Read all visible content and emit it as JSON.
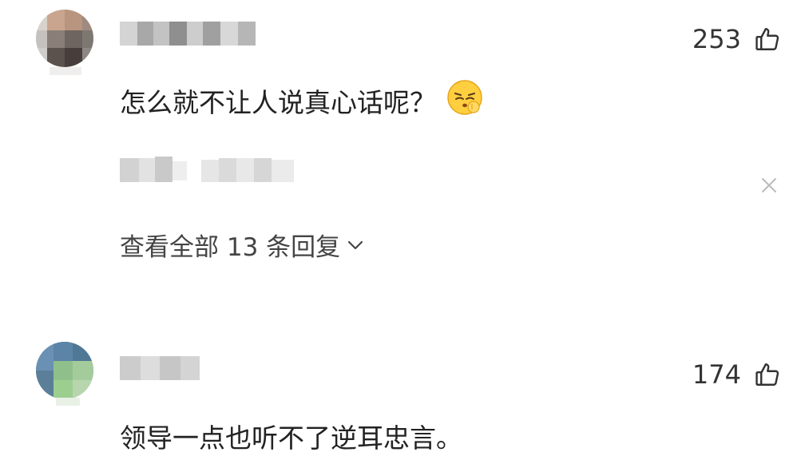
{
  "comments": [
    {
      "likes": "253",
      "text": "怎么就不让人说真心话呢？",
      "emoji": "shushing-face-emoji",
      "replies_label": "查看全部 13 条回复"
    },
    {
      "likes": "174",
      "text": "领导一点也听不了逆耳忠言。"
    }
  ],
  "icons": {
    "like": "thumbs-up-icon",
    "close": "close-icon",
    "expand": "chevron-down-icon"
  },
  "colors": {
    "text": "#222222",
    "secondary": "#444444",
    "muted": "#bbbbbb"
  }
}
